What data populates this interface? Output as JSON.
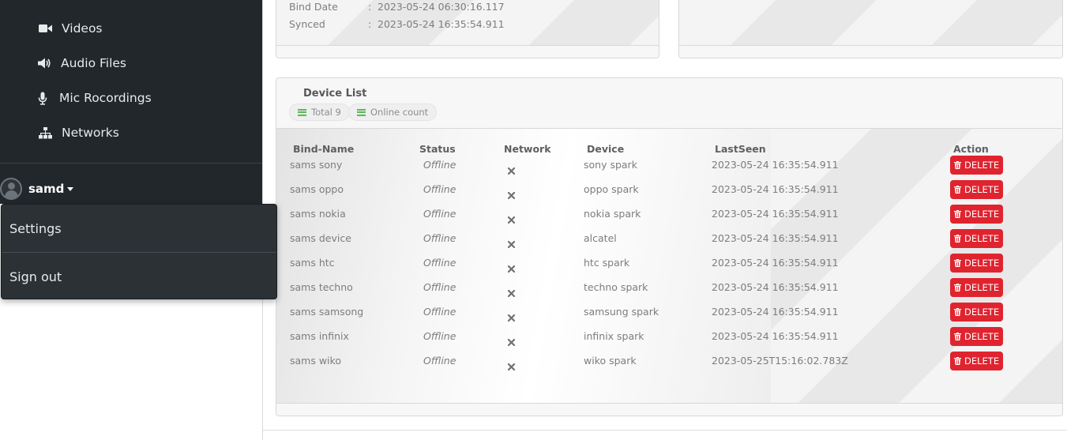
{
  "sidebar": {
    "items": [
      {
        "label": "Videos",
        "icon": "video-icon"
      },
      {
        "label": "Audio Files",
        "icon": "volume-icon"
      },
      {
        "label": "Mic Rocordings",
        "icon": "microphone-icon"
      },
      {
        "label": "Networks",
        "icon": "sitemap-icon"
      }
    ],
    "user": {
      "name": "samd"
    }
  },
  "user_menu": {
    "settings": "Settings",
    "sign_out": "Sign out"
  },
  "info_card": {
    "rows": [
      {
        "label": "Bind Date",
        "value": "2023-05-24 06:30:16.117"
      },
      {
        "label": "Synced",
        "value": "2023-05-24 16:35:54.911"
      }
    ],
    "separator": ":"
  },
  "device_list": {
    "title": "Device List",
    "total": "Total 9",
    "online": "Online count",
    "columns": [
      "Bind-Name",
      "Status",
      "Network",
      "Device",
      "LastSeen",
      "Action"
    ],
    "delete_label": "DELETE",
    "rows": [
      {
        "name": "sams sony",
        "status": "Offline",
        "device": "sony spark",
        "last_seen": "2023-05-24 16:35:54.911"
      },
      {
        "name": "sams oppo",
        "status": "Offline",
        "device": "oppo spark",
        "last_seen": "2023-05-24 16:35:54.911"
      },
      {
        "name": "sams nokia",
        "status": "Offline",
        "device": "nokia spark",
        "last_seen": "2023-05-24 16:35:54.911"
      },
      {
        "name": "sams device",
        "status": "Offline",
        "device": "alcatel",
        "last_seen": "2023-05-24 16:35:54.911"
      },
      {
        "name": "sams htc",
        "status": "Offline",
        "device": "htc spark",
        "last_seen": "2023-05-24 16:35:54.911"
      },
      {
        "name": "sams techno",
        "status": "Offline",
        "device": "techno spark",
        "last_seen": "2023-05-24 16:35:54.911"
      },
      {
        "name": "sams samsong",
        "status": "Offline",
        "device": "samsung spark",
        "last_seen": "2023-05-24 16:35:54.911"
      },
      {
        "name": "sams infinix",
        "status": "Offline",
        "device": "infinix spark",
        "last_seen": "2023-05-24 16:35:54.911"
      },
      {
        "name": "sams wiko",
        "status": "Offline",
        "device": "wiko spark",
        "last_seen": "2023-05-25T15:16:02.783Z"
      }
    ]
  },
  "colors": {
    "sidebar_bg": "#22272b",
    "dropdown_bg": "#2c3136",
    "delete_red": "#e0242f",
    "pill_icon_green": "#5cb85c"
  }
}
